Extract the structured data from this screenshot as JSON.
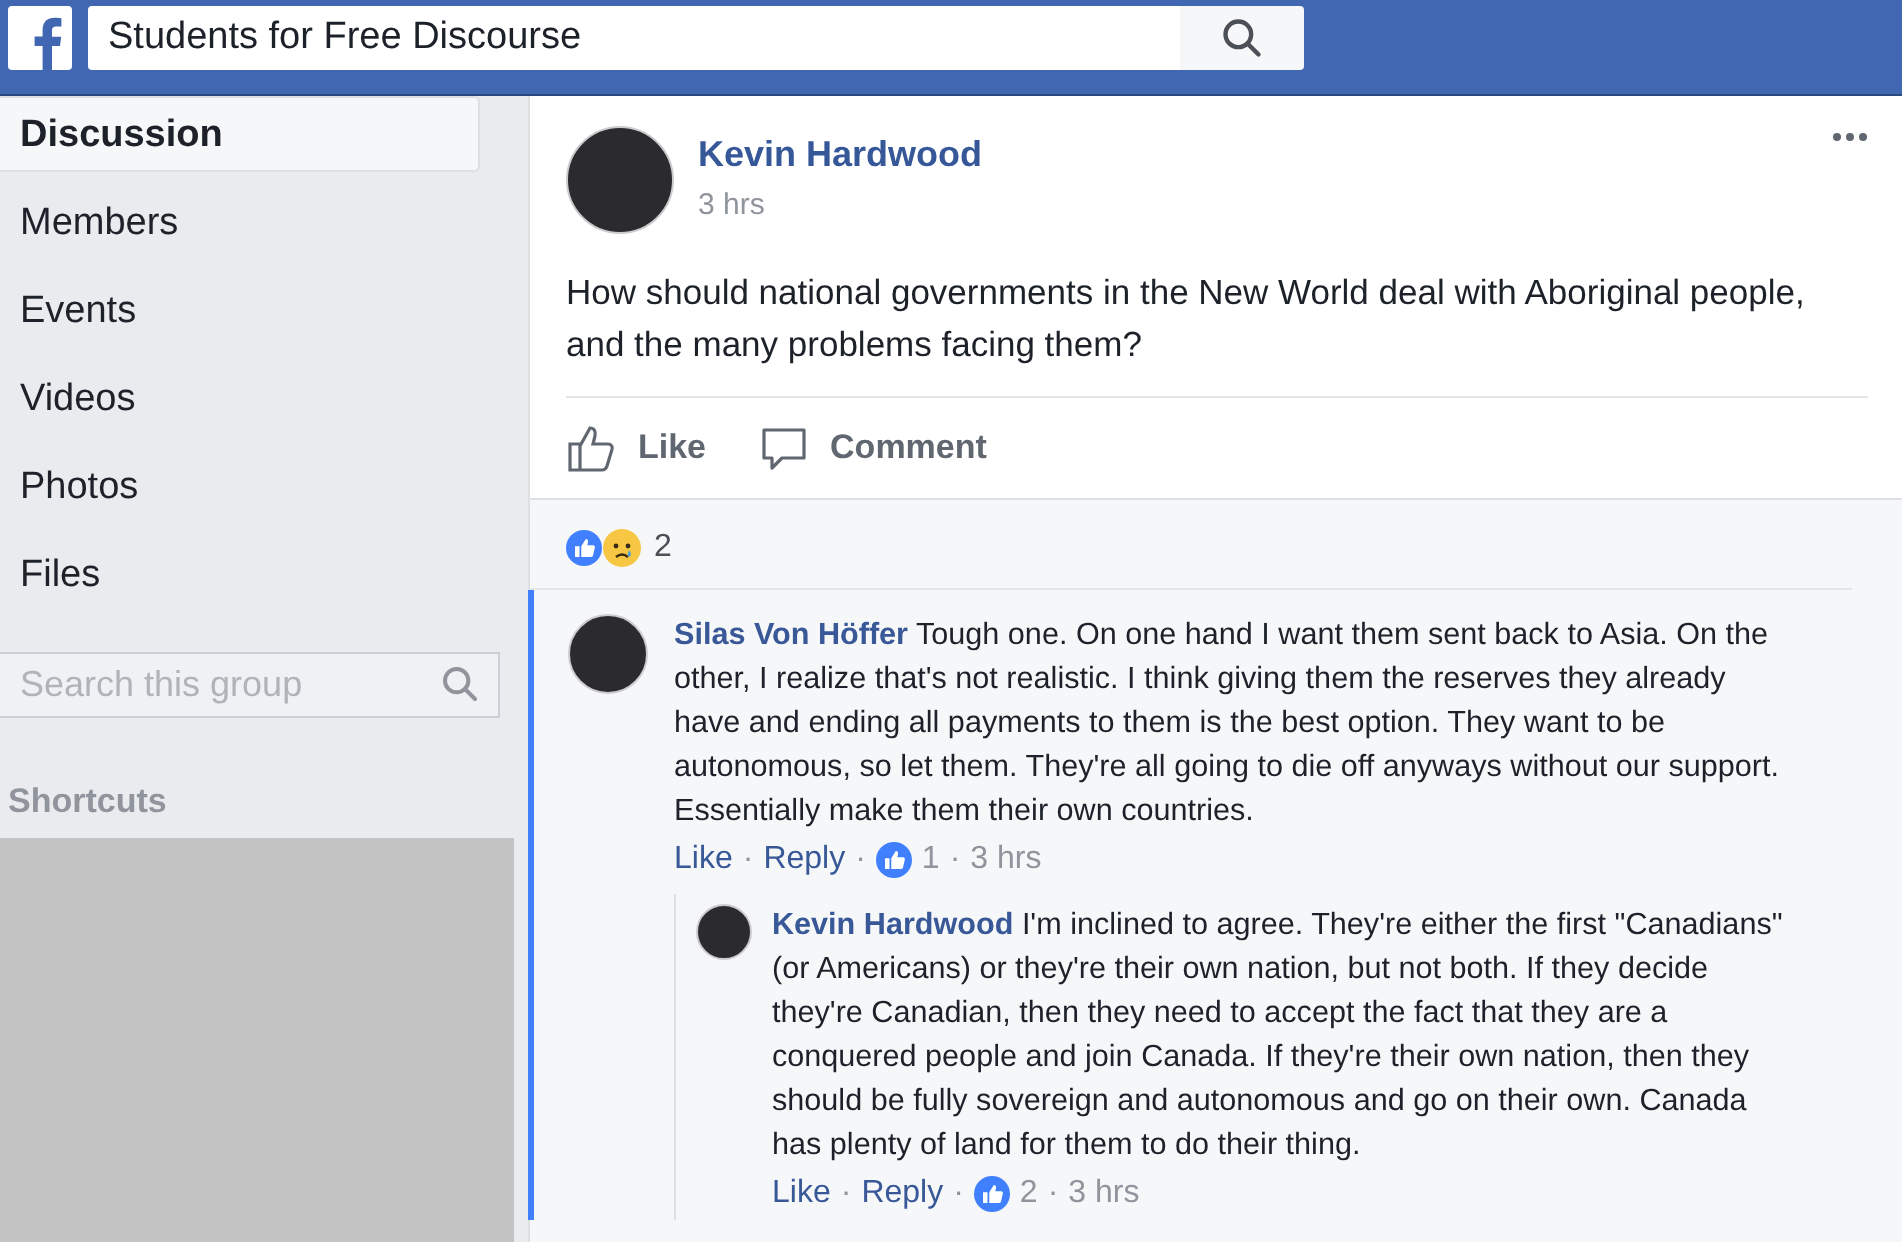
{
  "header": {
    "search": {
      "value": "Students for Free Discourse"
    }
  },
  "sidebar": {
    "items": [
      {
        "label": "Discussion",
        "selected": true
      },
      {
        "label": "Members",
        "selected": false
      },
      {
        "label": "Events",
        "selected": false
      },
      {
        "label": "Videos",
        "selected": false
      },
      {
        "label": "Photos",
        "selected": false
      },
      {
        "label": "Files",
        "selected": false
      }
    ],
    "search": {
      "placeholder": "Search this group"
    },
    "shortcuts_title": "Shortcuts"
  },
  "post": {
    "author": "Kevin Hardwood",
    "time": "3 hrs",
    "text": "How should national governments in the New World deal with Aboriginal people, and the many problems facing them?",
    "actions": [
      {
        "kind": "like",
        "label": "Like"
      },
      {
        "kind": "comment",
        "label": "Comment"
      }
    ],
    "reactions": [
      {
        "kind": "like"
      },
      {
        "kind": "sad"
      }
    ],
    "reaction_count": "2"
  },
  "comments": [
    {
      "author": "Silas Von Höffer",
      "text": "Tough one. On one hand I want them sent back to Asia. On the other, I realize that's not realistic. I think giving them the reserves they already have and ending all payments to them is the best option. They want to be autonomous, so let them. They're all going to die off anyways without our support. Essentially make them their own countries.",
      "highlighted": true,
      "meta": [
        {
          "kind": "link",
          "text": "Like"
        },
        {
          "kind": "sep",
          "text": "·"
        },
        {
          "kind": "link",
          "text": "Reply"
        },
        {
          "kind": "sep",
          "text": "·"
        },
        {
          "kind": "likes",
          "text": "1"
        },
        {
          "kind": "sep",
          "text": "·"
        },
        {
          "kind": "time",
          "text": "3 hrs"
        }
      ],
      "children": [
        {
          "author": "Kevin Hardwood",
          "text": "I'm inclined to agree. They're either the first \"Canadians\" (or Americans) or they're their own nation, but not both. If they decide they're Canadian, then they need to accept the fact that they are a conquered people and join Canada. If they're their own nation, then they should be fully sovereign and autonomous and go on their own. Canada has plenty of land for them to do their thing.",
          "highlighted": false,
          "meta": [
            {
              "kind": "link",
              "text": "Like"
            },
            {
              "kind": "sep",
              "text": "·"
            },
            {
              "kind": "link",
              "text": "Reply"
            },
            {
              "kind": "sep",
              "text": "·"
            },
            {
              "kind": "likes",
              "text": "2"
            },
            {
              "kind": "sep",
              "text": "·"
            },
            {
              "kind": "time",
              "text": "3 hrs"
            }
          ]
        }
      ]
    }
  ]
}
